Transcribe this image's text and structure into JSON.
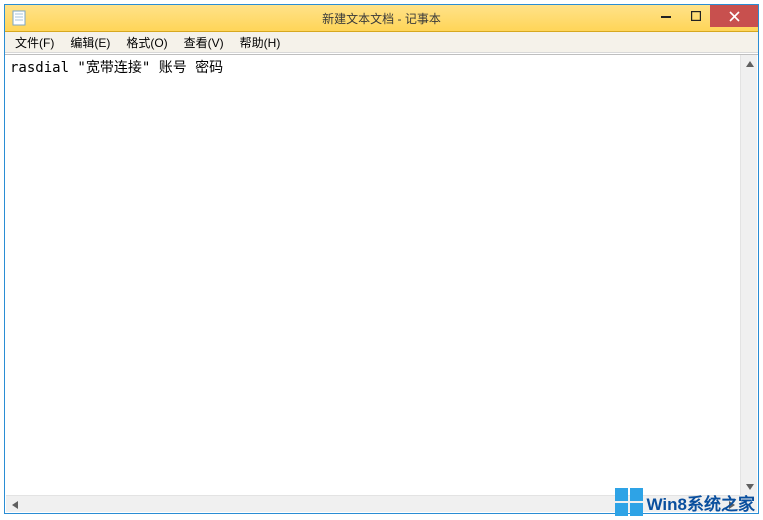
{
  "window": {
    "title": "新建文本文档 - 记事本"
  },
  "menu": {
    "items": [
      {
        "label": "文件(F)"
      },
      {
        "label": "编辑(E)"
      },
      {
        "label": "格式(O)"
      },
      {
        "label": "查看(V)"
      },
      {
        "label": "帮助(H)"
      }
    ]
  },
  "editor": {
    "content": "rasdial \"宽带连接\" 账号 密码"
  },
  "watermark": {
    "text": "Win8系统之家"
  }
}
